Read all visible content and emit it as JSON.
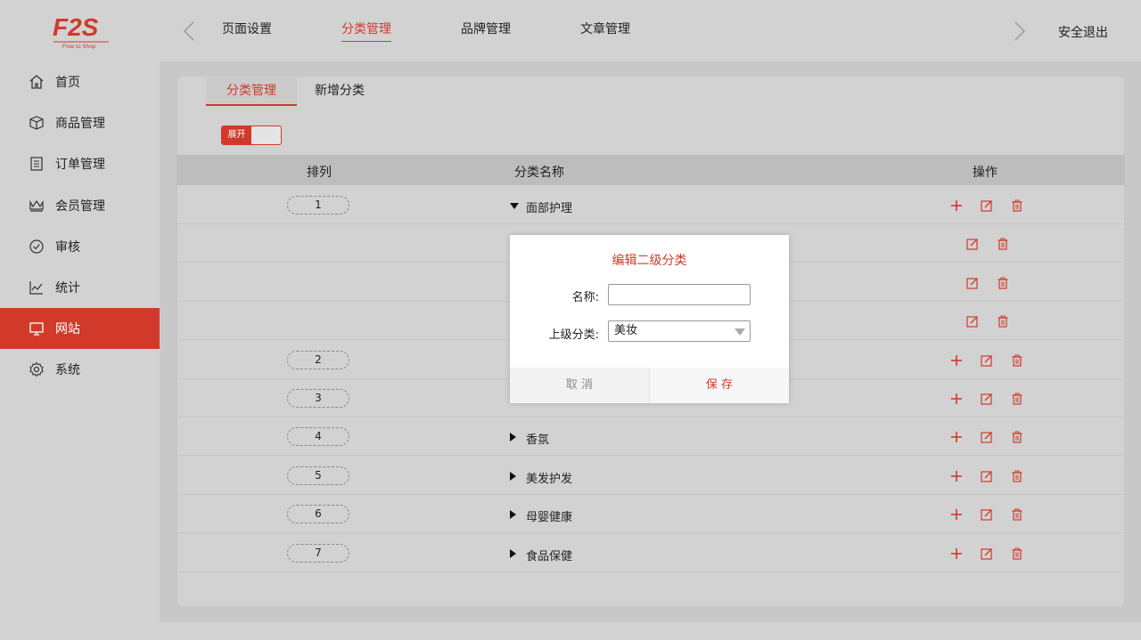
{
  "brand": {
    "logo_text": "F2S",
    "logo_sub": "Free to Shop",
    "accent": "#d13a2b"
  },
  "top_nav": {
    "items": [
      "页面设置",
      "分类管理",
      "品牌管理",
      "文章管理"
    ],
    "active_index": 1,
    "logout": "安全退出"
  },
  "sidebar": {
    "items": [
      {
        "label": "首页",
        "icon": "home-icon"
      },
      {
        "label": "商品管理",
        "icon": "box-icon"
      },
      {
        "label": "订单管理",
        "icon": "clipboard-icon"
      },
      {
        "label": "会员管理",
        "icon": "crown-icon"
      },
      {
        "label": "审核",
        "icon": "check-circle-icon"
      },
      {
        "label": "统计",
        "icon": "chart-icon"
      },
      {
        "label": "网站",
        "icon": "monitor-icon"
      },
      {
        "label": "系统",
        "icon": "gear-icon"
      }
    ],
    "active_index": 6
  },
  "tabs": {
    "active": "分类管理",
    "other": "新增分类"
  },
  "toggle": {
    "label": "展开",
    "state": "on"
  },
  "table": {
    "headers": {
      "sort": "排列",
      "name": "分类名称",
      "ops": "操作"
    },
    "rows": [
      {
        "sort": "1",
        "name": "面部护理",
        "expanded": true,
        "level": 1
      },
      {
        "sort": "",
        "name": "",
        "level": 2
      },
      {
        "sort": "",
        "name": "",
        "level": 2
      },
      {
        "sort": "",
        "name": "",
        "level": 2
      },
      {
        "sort": "2",
        "name": "",
        "expanded": false,
        "level": 1
      },
      {
        "sort": "3",
        "name": "",
        "expanded": false,
        "level": 1
      },
      {
        "sort": "4",
        "name": "香氛",
        "expanded": false,
        "level": 1
      },
      {
        "sort": "5",
        "name": "美发护发",
        "expanded": false,
        "level": 1
      },
      {
        "sort": "6",
        "name": "母婴健康",
        "expanded": false,
        "level": 1
      },
      {
        "sort": "7",
        "name": "食品保健",
        "expanded": false,
        "level": 1
      }
    ]
  },
  "modal": {
    "title": "编辑二级分类",
    "name_label": "名称:",
    "name_value": "",
    "parent_label": "上级分类:",
    "parent_value": "美妆",
    "cancel": "取 消",
    "save": "保 存"
  }
}
